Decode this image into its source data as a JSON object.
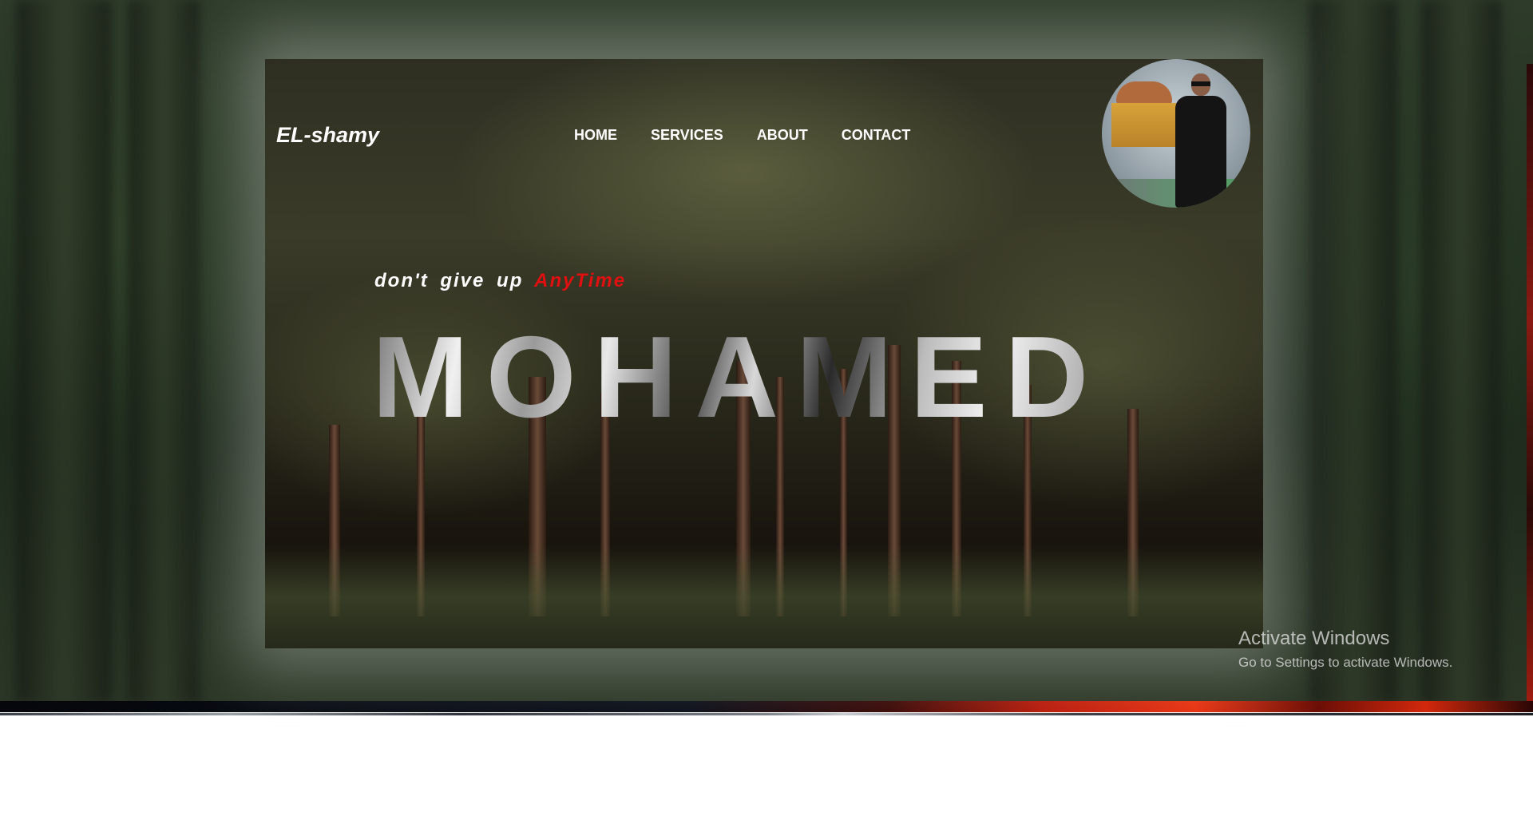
{
  "site": {
    "logo": "EL-shamy",
    "nav": [
      "HOME",
      "SERVICES",
      "ABOUT",
      "CONTACT"
    ]
  },
  "hero": {
    "tagline_white": "don't give up",
    "tagline_red": "AnyTime",
    "name": "MOHAMED"
  },
  "os_watermark": {
    "title": "Activate Windows",
    "subtitle": "Go to Settings to activate Windows."
  },
  "colors": {
    "accent": "#e01010",
    "text": "#ffffff"
  }
}
